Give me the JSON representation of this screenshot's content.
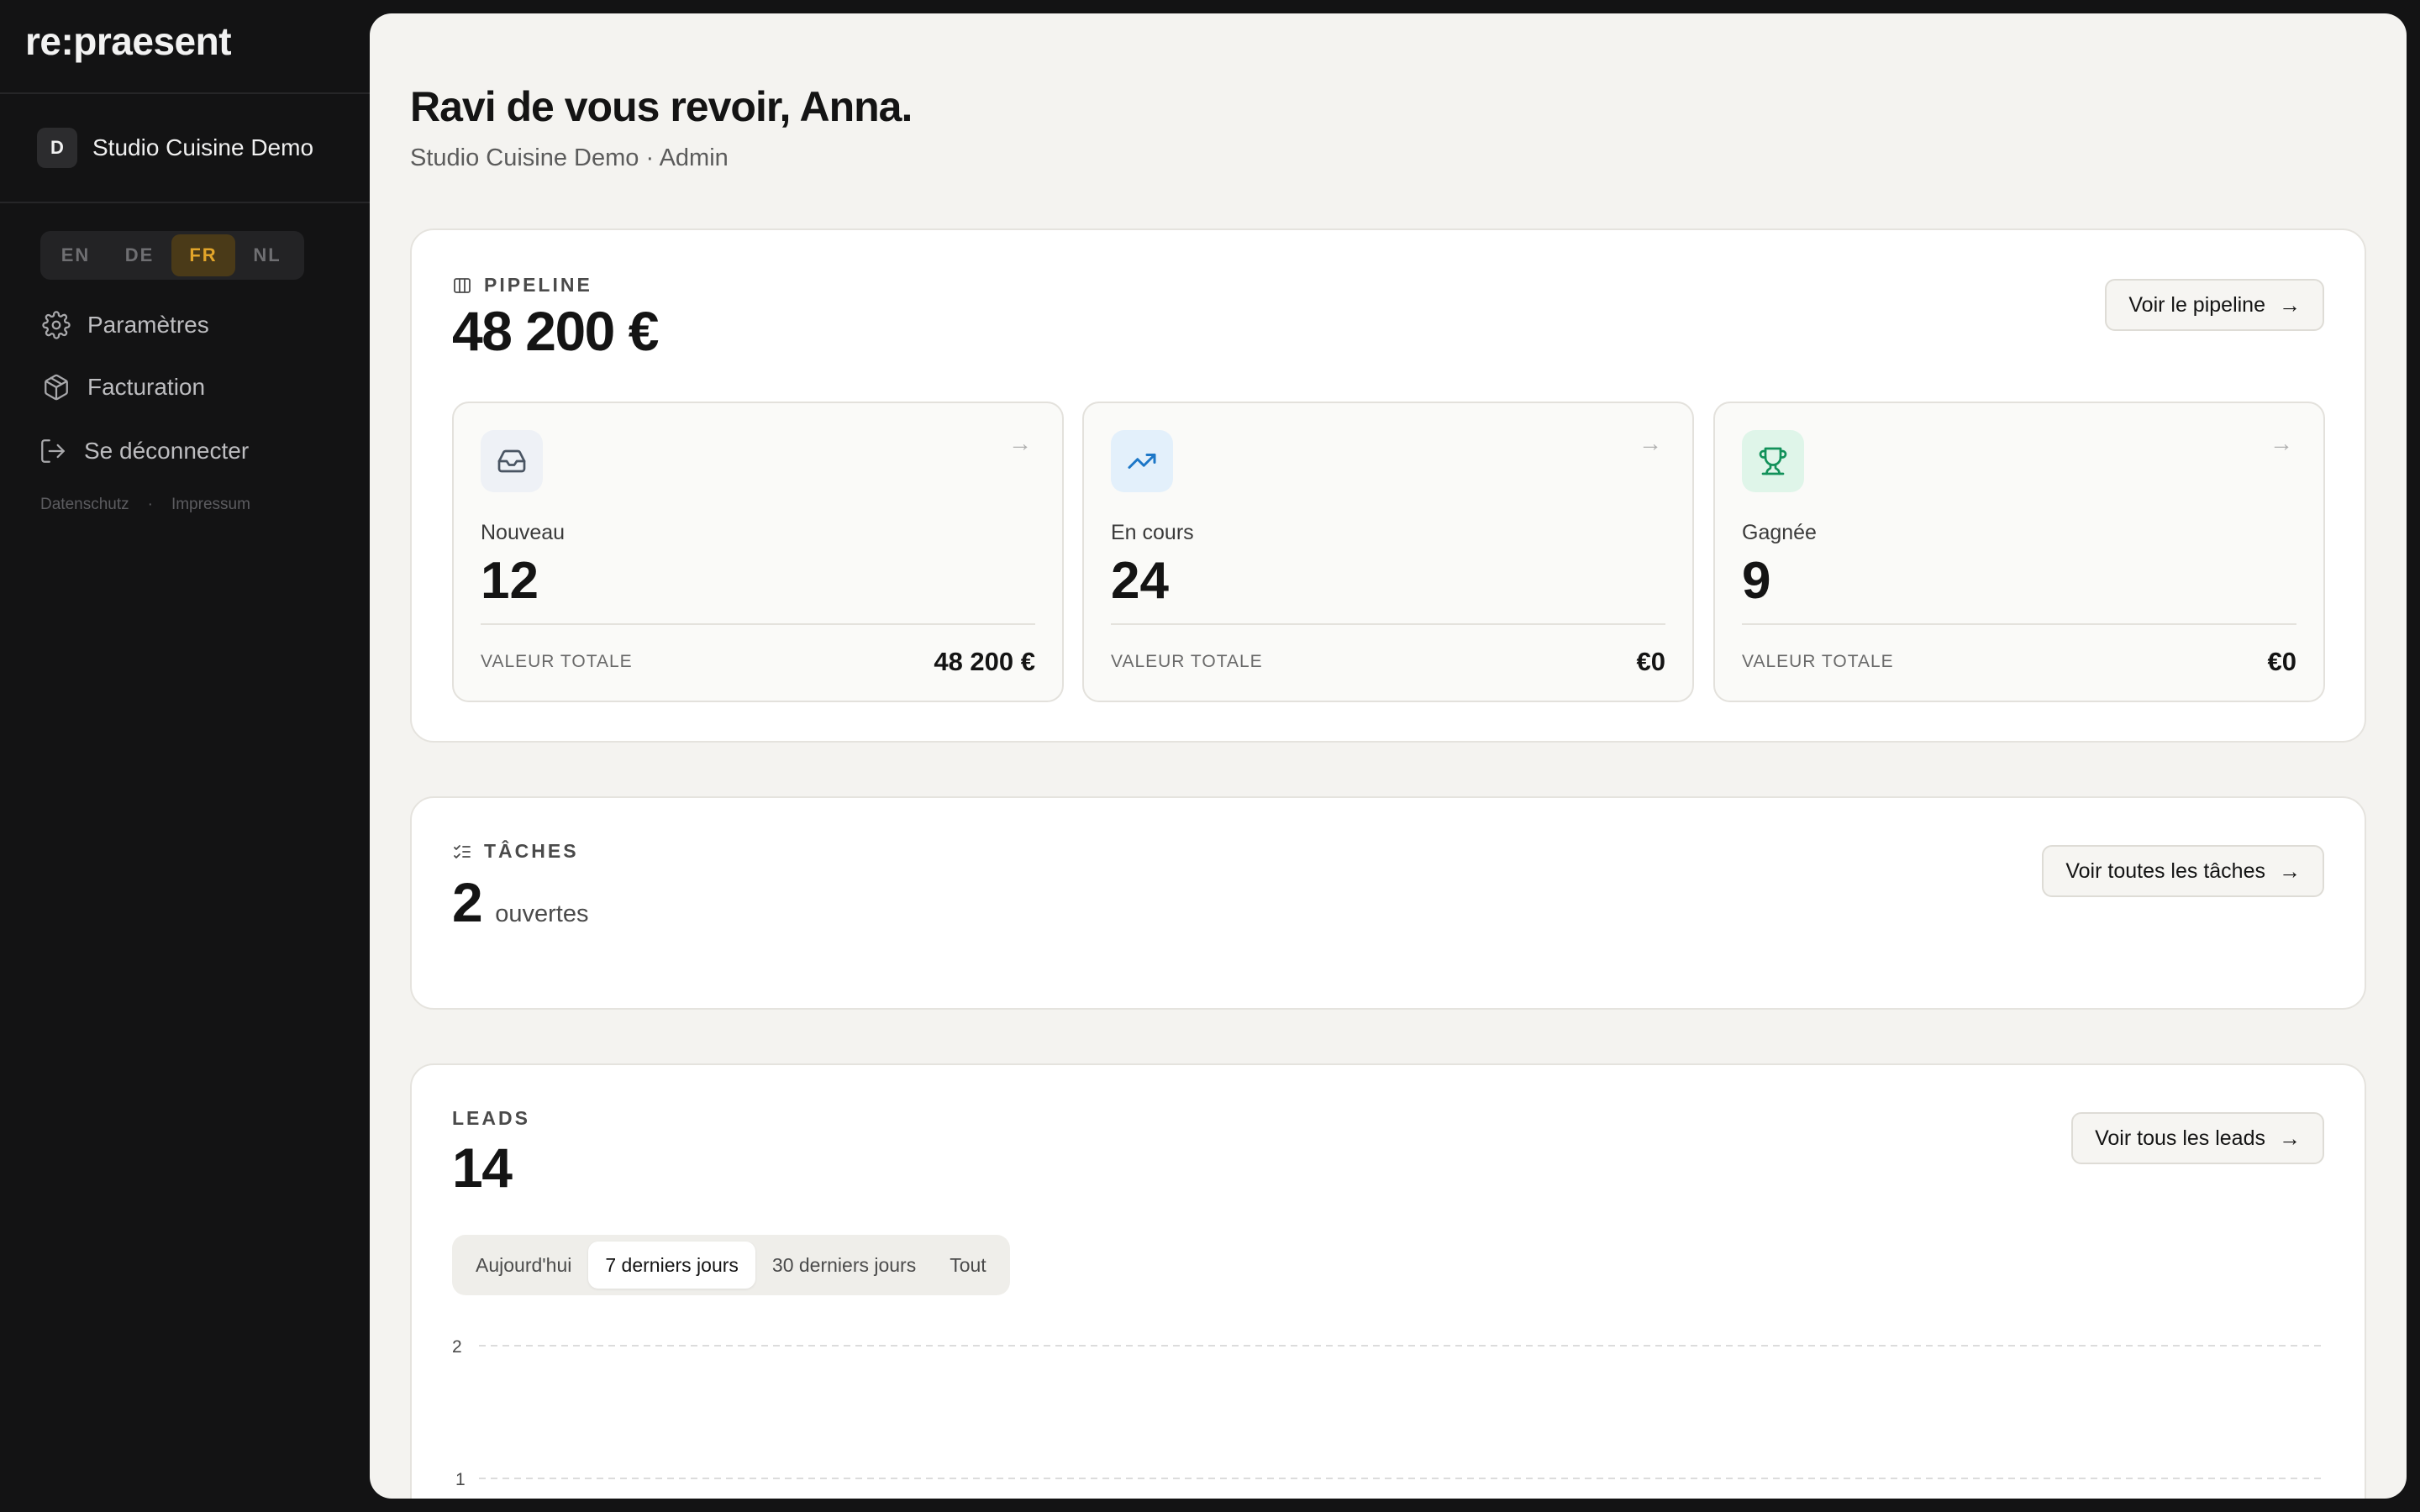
{
  "app": {
    "logo": "re:praesent"
  },
  "sidebar": {
    "org": {
      "initial": "D",
      "name": "Studio Cuisine Demo"
    },
    "languages": [
      {
        "code": "EN",
        "active": false
      },
      {
        "code": "DE",
        "active": false
      },
      {
        "code": "FR",
        "active": true
      },
      {
        "code": "NL",
        "active": false
      }
    ],
    "nav": [
      {
        "label": "Paramètres",
        "icon": "gear-icon"
      },
      {
        "label": "Facturation",
        "icon": "package-icon"
      },
      {
        "label": "Se déconnecter",
        "icon": "logout-icon"
      }
    ],
    "footer_links": [
      "Datenschutz",
      "·",
      "Impressum"
    ]
  },
  "header": {
    "greeting": "Ravi de vous revoir, Anna.",
    "subtitle": "Studio Cuisine Demo · Admin"
  },
  "pipeline": {
    "label": "PIPELINE",
    "total": "48 200 €",
    "button": "Voir le pipeline",
    "stages": [
      {
        "label": "Nouveau",
        "count": "12",
        "total_label": "VALEUR TOTALE",
        "total_value": "48 200 €",
        "icon": "inbox-icon",
        "accent": "#eef1f6"
      },
      {
        "label": "En cours",
        "count": "24",
        "total_label": "VALEUR TOTALE",
        "total_value": "€0",
        "icon": "trending-up-icon",
        "accent": "#e3f0fb"
      },
      {
        "label": "Gagnée",
        "count": "9",
        "total_label": "VALEUR TOTALE",
        "total_value": "€0",
        "icon": "trophy-icon",
        "accent": "#dff5e9"
      }
    ]
  },
  "tasks": {
    "label": "TÂCHES",
    "count": "2",
    "suffix": "ouvertes",
    "button": "Voir toutes les tâches"
  },
  "leads": {
    "label": "LEADS",
    "count": "14",
    "button": "Voir tous les leads",
    "ranges": [
      {
        "label": "Aujourd'hui",
        "active": false
      },
      {
        "label": "7 derniers jours",
        "active": true
      },
      {
        "label": "30 derniers jours",
        "active": false
      },
      {
        "label": "Tout",
        "active": false
      }
    ],
    "chart": {
      "y_ticks": [
        "2",
        "1"
      ]
    }
  },
  "colors": {
    "accent_lang": "#e2a52a",
    "sidebar_bg": "#131314",
    "main_bg": "#f4f3f0"
  }
}
